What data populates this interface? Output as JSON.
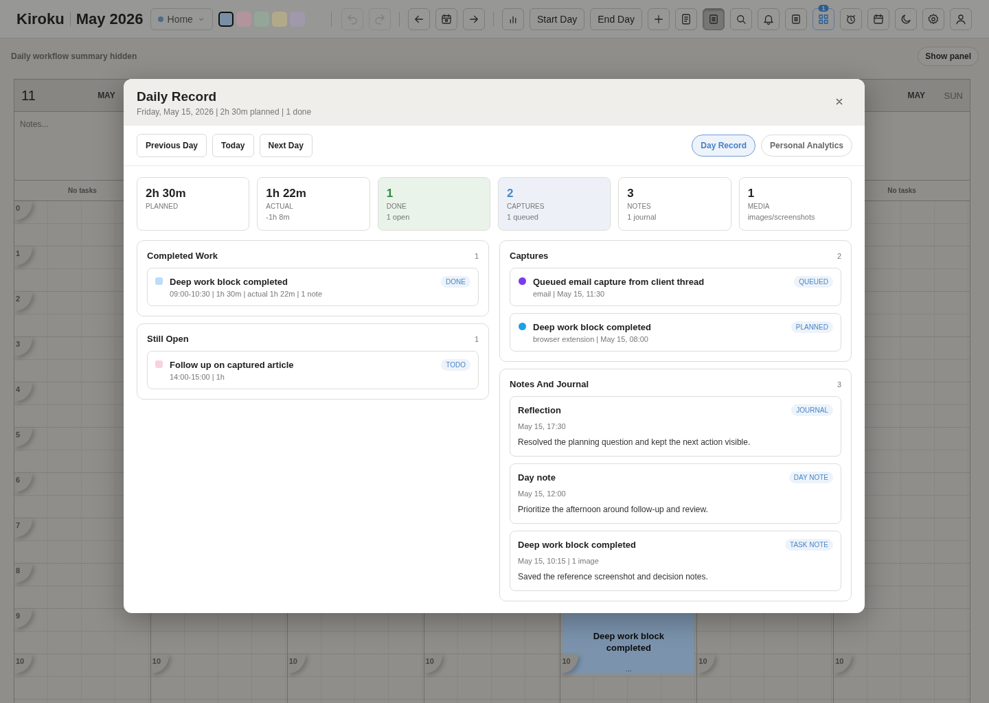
{
  "app_bar": {
    "title": "Kiroku",
    "month": "May 2026",
    "workspace": "Home",
    "swatches": [
      {
        "color": "#7a8fa6",
        "selected": true
      },
      {
        "color": "#b2949c",
        "selected": false
      },
      {
        "color": "#93a698",
        "selected": false
      },
      {
        "color": "#b1a98a",
        "selected": false
      },
      {
        "color": "#a098ab",
        "selected": false
      }
    ],
    "toolbar": [
      {
        "kind": "separator"
      },
      {
        "kind": "icon",
        "disabled": true,
        "pressed": false,
        "highlighted": false
      },
      {
        "kind": "icon",
        "disabled": true,
        "pressed": false,
        "highlighted": false
      },
      {
        "kind": "separator"
      },
      {
        "kind": "icon",
        "disabled": false,
        "pressed": false,
        "highlighted": false
      },
      {
        "kind": "icon",
        "disabled": false,
        "pressed": false,
        "highlighted": false
      },
      {
        "kind": "icon",
        "disabled": false,
        "pressed": false,
        "highlighted": false
      },
      {
        "kind": "separator"
      },
      {
        "kind": "icon",
        "disabled": false,
        "pressed": false,
        "highlighted": false
      },
      {
        "kind": "text",
        "label": "Start Day"
      },
      {
        "kind": "text",
        "label": "End Day"
      },
      {
        "kind": "icon",
        "disabled": false,
        "pressed": false,
        "highlighted": false
      },
      {
        "kind": "icon",
        "disabled": false,
        "pressed": false,
        "highlighted": false
      },
      {
        "kind": "icon",
        "disabled": false,
        "pressed": true,
        "highlighted": false
      },
      {
        "kind": "icon",
        "disabled": false,
        "pressed": false,
        "highlighted": false
      },
      {
        "kind": "icon",
        "disabled": false,
        "pressed": false,
        "highlighted": false
      },
      {
        "kind": "icon",
        "disabled": false,
        "pressed": false,
        "highlighted": false
      },
      {
        "kind": "icon",
        "disabled": false,
        "pressed": false,
        "highlighted": true,
        "badge": "1"
      },
      {
        "kind": "icon",
        "disabled": false,
        "pressed": false,
        "highlighted": false
      },
      {
        "kind": "icon",
        "disabled": false,
        "pressed": false,
        "highlighted": false
      },
      {
        "kind": "icon",
        "disabled": false,
        "pressed": false,
        "highlighted": false
      },
      {
        "kind": "icon",
        "disabled": false,
        "pressed": false,
        "highlighted": false
      },
      {
        "kind": "icon",
        "disabled": false,
        "pressed": false,
        "highlighted": false
      }
    ]
  },
  "summary_bar": {
    "message": "Daily workflow summary hidden",
    "button": "Show panel"
  },
  "calendar": {
    "columns": [
      {
        "day": "11",
        "month": "MAY",
        "notes": "Notes...",
        "summary": "No tasks",
        "hours": [
          "0",
          "1",
          "2",
          "3",
          "4",
          "5",
          "6",
          "7",
          "8",
          "9",
          "10"
        ]
      },
      {
        "hours": [
          "10"
        ]
      },
      {
        "hours": [
          "10"
        ]
      },
      {
        "hours": [
          "10"
        ]
      },
      {
        "hours": [
          "10"
        ],
        "event": {
          "title": "Deep work block completed",
          "more": "..."
        }
      },
      {
        "hours": [
          "10"
        ]
      },
      {
        "month": "MAY",
        "weekday": "SUN",
        "summary": "No tasks",
        "hours": [
          "10"
        ]
      }
    ]
  },
  "daily_record": {
    "title": "Daily Record",
    "subtitle": "Friday, May 15, 2026 | 2h 30m planned | 1 done",
    "nav": [
      "Previous Day",
      "Today",
      "Next Day"
    ],
    "views": [
      {
        "label": "Day Record",
        "selected": true
      },
      {
        "label": "Personal Analytics",
        "selected": false
      }
    ],
    "stats": [
      {
        "kind": "plain",
        "value": "2h 30m",
        "label": "PLANNED"
      },
      {
        "kind": "plain",
        "value": "1h 22m",
        "label": "ACTUAL",
        "detail": "-1h 8m"
      },
      {
        "kind": "success",
        "value": "1",
        "label": "DONE",
        "detail": "1 open"
      },
      {
        "kind": "info",
        "value": "2",
        "label": "CAPTURES",
        "detail": "1 queued"
      },
      {
        "kind": "plain",
        "value": "3",
        "label": "NOTES",
        "detail": "1 journal"
      },
      {
        "kind": "plain",
        "value": "1",
        "label": "MEDIA",
        "detail": "images/screenshots"
      }
    ],
    "left_column": [
      {
        "title": "Completed Work",
        "count": "1",
        "items": [
          {
            "kind": "task",
            "title": "Deep work block completed",
            "meta": "09:00-10:30 | 1h 30m | actual 1h 22m | 1 note",
            "tag": "DONE",
            "color": "#bcdcf7"
          }
        ]
      },
      {
        "title": "Still Open",
        "count": "1",
        "items": [
          {
            "kind": "task",
            "title": "Follow up on captured article",
            "meta": "14:00-15:00 | 1h",
            "tag": "TODO",
            "color": "#f8d3df"
          }
        ]
      }
    ],
    "right_column": [
      {
        "title": "Captures",
        "count": "2",
        "items": [
          {
            "kind": "capture",
            "title": "Queued email capture from client thread",
            "meta": "email | May 15, 11:30",
            "tag": "QUEUED",
            "color": "#7c3aed"
          },
          {
            "kind": "capture",
            "title": "Deep work block completed",
            "meta": "browser extension | May 15, 08:00",
            "tag": "PLANNED",
            "color": "#1ea0e8"
          }
        ]
      },
      {
        "title": "Notes And Journal",
        "count": "3",
        "items": [
          {
            "kind": "note",
            "title": "Reflection",
            "tag": "JOURNAL",
            "date": "May 15, 17:30",
            "body": "Resolved the planning question and kept the next action visible."
          },
          {
            "kind": "note",
            "title": "Day note",
            "tag": "DAY NOTE",
            "date": "May 15, 12:00",
            "body": "Prioritize the afternoon around follow-up and review."
          },
          {
            "kind": "note",
            "title": "Deep work block completed",
            "tag": "TASK NOTE",
            "date": "May 15, 10:15 | 1 image",
            "body": "Saved the reference screenshot and decision notes."
          }
        ]
      }
    ]
  }
}
